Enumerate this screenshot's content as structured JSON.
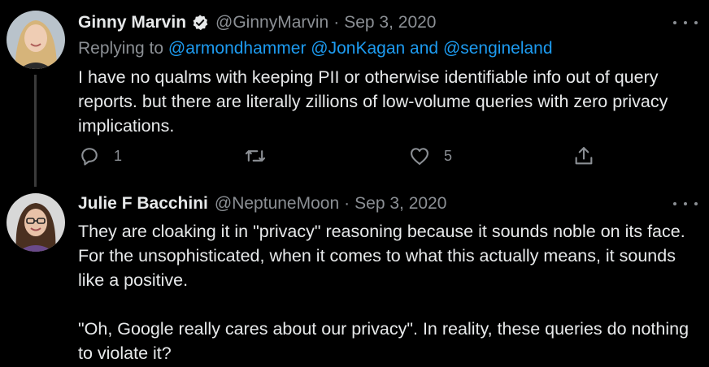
{
  "tweets": [
    {
      "display_name": "Ginny Marvin",
      "handle": "@GinnyMarvin",
      "separator": "·",
      "date": "Sep 3, 2020",
      "verified": true,
      "replying_to_label": "Replying to",
      "mention_1": "@armondhammer",
      "mention_2": "@JonKagan",
      "and_label": "and",
      "mention_3": "@sengineland",
      "body": [
        "I have no qualms with keeping PII or otherwise identifiable info out of query reports. but there are literally zillions of low-volume queries with zero privacy implications."
      ],
      "reply_count": "1",
      "like_count": "5",
      "icons": [
        "reply-icon",
        "retweet-icon",
        "like-icon",
        "share-icon",
        "more-icon"
      ]
    },
    {
      "display_name": "Julie F Bacchini",
      "handle": "@NeptuneMoon",
      "separator": "·",
      "date": "Sep 3, 2020",
      "body": [
        "They are cloaking it in \"privacy\" reasoning because it sounds noble on its face. For the unsophisticated, when it comes to what this actually means, it sounds like a positive.",
        "\"Oh, Google really cares about our privacy\". In reality, these queries do nothing to violate it?"
      ]
    }
  ],
  "colors": {
    "background": "#000000",
    "text": "#e7e9ea",
    "secondary": "#8b8f94",
    "link": "#1d9bf0",
    "thread_line": "#3a3a3a"
  }
}
